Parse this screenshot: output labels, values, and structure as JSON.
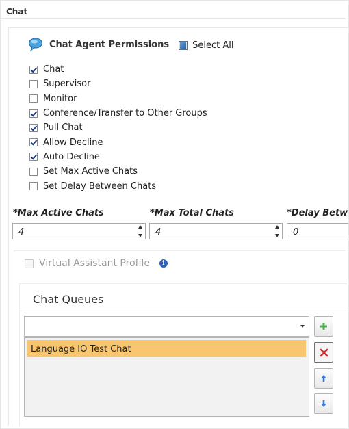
{
  "panel": {
    "title": "Chat"
  },
  "permissions": {
    "title": "Chat Agent Permissions",
    "select_all": {
      "label": "Select All",
      "checked": true
    },
    "items": [
      {
        "label": "Chat",
        "checked": true
      },
      {
        "label": "Supervisor",
        "checked": false
      },
      {
        "label": "Monitor",
        "checked": false
      },
      {
        "label": "Conference/Transfer to Other Groups",
        "checked": true
      },
      {
        "label": "Pull Chat",
        "checked": true
      },
      {
        "label": "Allow Decline",
        "checked": true
      },
      {
        "label": "Auto Decline",
        "checked": true
      },
      {
        "label": "Set Max Active Chats",
        "checked": false
      },
      {
        "label": "Set Delay Between Chats",
        "checked": false
      }
    ]
  },
  "limits": {
    "max_active": {
      "label": "*Max Active Chats",
      "value": "4"
    },
    "max_total": {
      "label": "*Max Total Chats",
      "value": "4"
    },
    "delay": {
      "label": "*Delay Betw",
      "value": "0"
    }
  },
  "virtual_assistant": {
    "label": "Virtual Assistant Profile",
    "checked": false,
    "enabled": false,
    "info_icon": "info-icon"
  },
  "chat_queues": {
    "title": "Chat Queues",
    "selected_value": "",
    "items": [
      {
        "label": "Language IO Test Chat",
        "selected": true
      }
    ],
    "buttons": [
      "add-icon",
      "remove-icon",
      "move-up-icon",
      "move-down-icon"
    ]
  },
  "colors": {
    "selected_row": "#f8c66e",
    "add_green": "#4caf50",
    "remove_red": "#d32f2f",
    "arrow_blue": "#3a7bd5",
    "info_blue": "#2b62b8"
  }
}
